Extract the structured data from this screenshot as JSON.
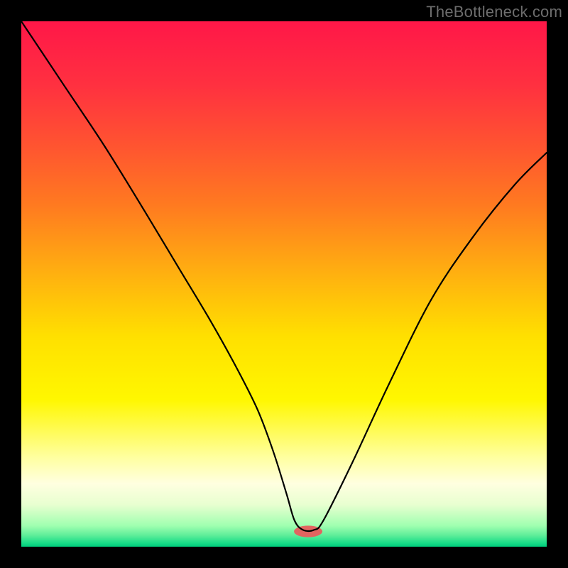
{
  "watermark": "TheBottleneck.com",
  "chart_data": {
    "type": "line",
    "title": "",
    "xlabel": "",
    "ylabel": "",
    "xlim": [
      0,
      100
    ],
    "ylim": [
      0,
      100
    ],
    "gradient_stops": [
      {
        "offset": 0.0,
        "color": "#ff1748"
      },
      {
        "offset": 0.12,
        "color": "#ff3040"
      },
      {
        "offset": 0.24,
        "color": "#ff5530"
      },
      {
        "offset": 0.35,
        "color": "#ff7a20"
      },
      {
        "offset": 0.48,
        "color": "#ffb010"
      },
      {
        "offset": 0.6,
        "color": "#ffe000"
      },
      {
        "offset": 0.72,
        "color": "#fff700"
      },
      {
        "offset": 0.83,
        "color": "#ffffa0"
      },
      {
        "offset": 0.88,
        "color": "#ffffe0"
      },
      {
        "offset": 0.92,
        "color": "#e8ffd0"
      },
      {
        "offset": 0.96,
        "color": "#a0ffb0"
      },
      {
        "offset": 0.978,
        "color": "#60ee9a"
      },
      {
        "offset": 0.993,
        "color": "#18dd88"
      },
      {
        "offset": 1.0,
        "color": "#00cc7d"
      }
    ],
    "series": [
      {
        "name": "bottleneck-curve",
        "x": [
          0.0,
          8.0,
          16.0,
          24.0,
          30.0,
          36.0,
          41.0,
          45.0,
          48.0,
          50.5,
          52.0,
          53.6,
          55.7,
          57.5,
          63.0,
          70.0,
          78.0,
          86.0,
          94.0,
          100.0
        ],
        "y": [
          100.0,
          88.0,
          76.0,
          63.0,
          53.0,
          43.0,
          34.0,
          26.0,
          18.0,
          10.0,
          5.0,
          3.2,
          3.2,
          5.0,
          16.0,
          31.0,
          47.0,
          59.0,
          69.0,
          75.0
        ]
      }
    ],
    "marker": {
      "cx": 54.6,
      "cy": 2.9,
      "rx": 2.7,
      "ry": 1.1,
      "color": "#e26460"
    }
  }
}
